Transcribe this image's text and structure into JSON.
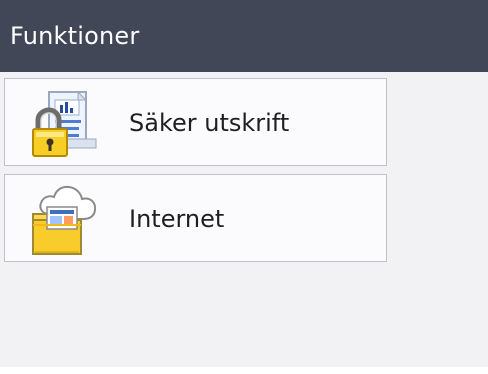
{
  "header": {
    "title": "Funktioner"
  },
  "menu": {
    "items": [
      {
        "label": "Säker utskrift",
        "icon": "secure-print-icon"
      },
      {
        "label": "Internet",
        "icon": "internet-folder-icon"
      }
    ]
  },
  "colors": {
    "header_background": "#424757",
    "header_text": "#ffffff",
    "content_background": "#f2f2f4",
    "item_background": "#fbfbfd",
    "item_border": "#bfc2c8",
    "item_text": "#1f1f1f"
  }
}
